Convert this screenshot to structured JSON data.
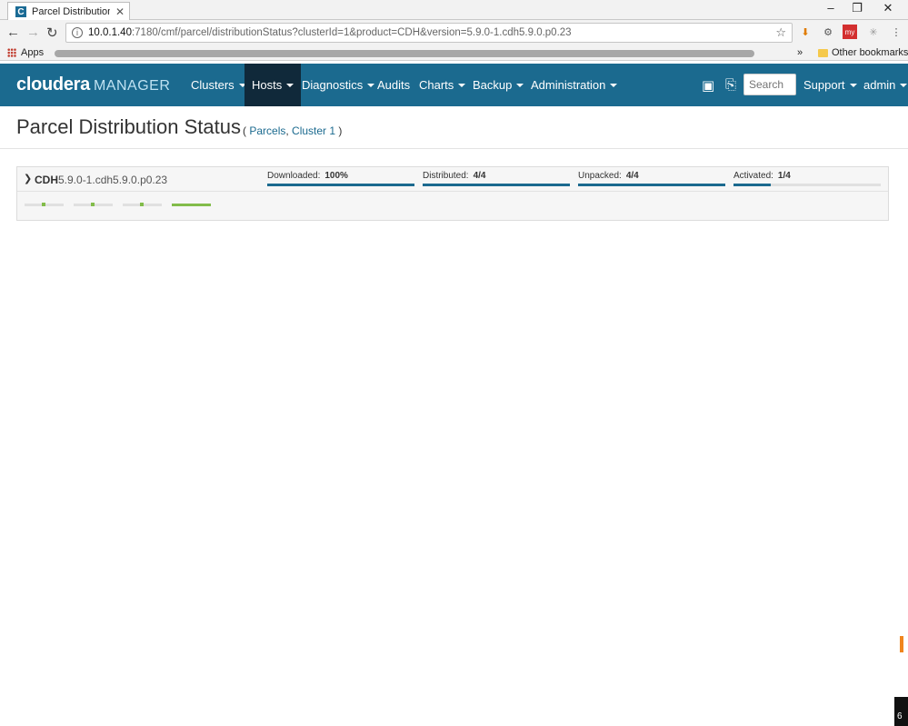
{
  "browser": {
    "tab_title": "Parcel Distribution S",
    "url_host": "10.0.1.40",
    "url_rest": ":7180/cmf/parcel/distributionStatus?clusterId=1&product=CDH&version=5.9.0-1.cdh5.9.0.p0.23",
    "bookmarks_apps": "Apps",
    "other_bookmarks": "Other bookmarks",
    "overflow": "»"
  },
  "nav": {
    "logo": "cloudera",
    "logo_sub": "MANAGER",
    "items": [
      {
        "label": "Clusters",
        "caret": true
      },
      {
        "label": "Hosts",
        "caret": true,
        "active": true
      },
      {
        "label": "Diagnostics",
        "caret": true
      },
      {
        "label": "Audits",
        "caret": false
      },
      {
        "label": "Charts",
        "caret": true
      },
      {
        "label": "Backup",
        "caret": true
      },
      {
        "label": "Administration",
        "caret": true
      }
    ],
    "search_placeholder": "Search",
    "support": "Support",
    "user": "admin"
  },
  "page": {
    "title": "Parcel Distribution Status",
    "crumb_open": "(",
    "crumb_parcels": "Parcels",
    "crumb_sep": ",",
    "crumb_cluster": "Cluster 1",
    "crumb_close": ")"
  },
  "parcel": {
    "name": "CDH",
    "version": "5.9.0-1.cdh5.9.0.p0.23",
    "stages": [
      {
        "label": "Downloaded:",
        "value": "100%",
        "fraction": 1.0
      },
      {
        "label": "Distributed:",
        "value": "4/4",
        "fraction": 1.0
      },
      {
        "label": "Unpacked:",
        "value": "4/4",
        "fraction": 1.0
      },
      {
        "label": "Activated:",
        "value": "1/4",
        "fraction": 0.25
      }
    ],
    "hosts": [
      {
        "state": "partial"
      },
      {
        "state": "partial"
      },
      {
        "state": "partial"
      },
      {
        "state": "full"
      }
    ]
  },
  "side_badge": "6"
}
